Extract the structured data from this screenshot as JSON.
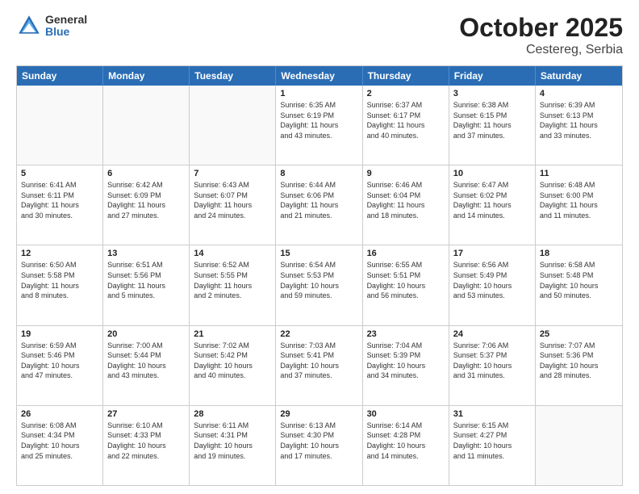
{
  "header": {
    "logo_general": "General",
    "logo_blue": "Blue",
    "title": "October 2025",
    "location": "Cestereg, Serbia"
  },
  "weekdays": [
    "Sunday",
    "Monday",
    "Tuesday",
    "Wednesday",
    "Thursday",
    "Friday",
    "Saturday"
  ],
  "rows": [
    [
      {
        "day": "",
        "info": ""
      },
      {
        "day": "",
        "info": ""
      },
      {
        "day": "",
        "info": ""
      },
      {
        "day": "1",
        "info": "Sunrise: 6:35 AM\nSunset: 6:19 PM\nDaylight: 11 hours\nand 43 minutes."
      },
      {
        "day": "2",
        "info": "Sunrise: 6:37 AM\nSunset: 6:17 PM\nDaylight: 11 hours\nand 40 minutes."
      },
      {
        "day": "3",
        "info": "Sunrise: 6:38 AM\nSunset: 6:15 PM\nDaylight: 11 hours\nand 37 minutes."
      },
      {
        "day": "4",
        "info": "Sunrise: 6:39 AM\nSunset: 6:13 PM\nDaylight: 11 hours\nand 33 minutes."
      }
    ],
    [
      {
        "day": "5",
        "info": "Sunrise: 6:41 AM\nSunset: 6:11 PM\nDaylight: 11 hours\nand 30 minutes."
      },
      {
        "day": "6",
        "info": "Sunrise: 6:42 AM\nSunset: 6:09 PM\nDaylight: 11 hours\nand 27 minutes."
      },
      {
        "day": "7",
        "info": "Sunrise: 6:43 AM\nSunset: 6:07 PM\nDaylight: 11 hours\nand 24 minutes."
      },
      {
        "day": "8",
        "info": "Sunrise: 6:44 AM\nSunset: 6:06 PM\nDaylight: 11 hours\nand 21 minutes."
      },
      {
        "day": "9",
        "info": "Sunrise: 6:46 AM\nSunset: 6:04 PM\nDaylight: 11 hours\nand 18 minutes."
      },
      {
        "day": "10",
        "info": "Sunrise: 6:47 AM\nSunset: 6:02 PM\nDaylight: 11 hours\nand 14 minutes."
      },
      {
        "day": "11",
        "info": "Sunrise: 6:48 AM\nSunset: 6:00 PM\nDaylight: 11 hours\nand 11 minutes."
      }
    ],
    [
      {
        "day": "12",
        "info": "Sunrise: 6:50 AM\nSunset: 5:58 PM\nDaylight: 11 hours\nand 8 minutes."
      },
      {
        "day": "13",
        "info": "Sunrise: 6:51 AM\nSunset: 5:56 PM\nDaylight: 11 hours\nand 5 minutes."
      },
      {
        "day": "14",
        "info": "Sunrise: 6:52 AM\nSunset: 5:55 PM\nDaylight: 11 hours\nand 2 minutes."
      },
      {
        "day": "15",
        "info": "Sunrise: 6:54 AM\nSunset: 5:53 PM\nDaylight: 10 hours\nand 59 minutes."
      },
      {
        "day": "16",
        "info": "Sunrise: 6:55 AM\nSunset: 5:51 PM\nDaylight: 10 hours\nand 56 minutes."
      },
      {
        "day": "17",
        "info": "Sunrise: 6:56 AM\nSunset: 5:49 PM\nDaylight: 10 hours\nand 53 minutes."
      },
      {
        "day": "18",
        "info": "Sunrise: 6:58 AM\nSunset: 5:48 PM\nDaylight: 10 hours\nand 50 minutes."
      }
    ],
    [
      {
        "day": "19",
        "info": "Sunrise: 6:59 AM\nSunset: 5:46 PM\nDaylight: 10 hours\nand 47 minutes."
      },
      {
        "day": "20",
        "info": "Sunrise: 7:00 AM\nSunset: 5:44 PM\nDaylight: 10 hours\nand 43 minutes."
      },
      {
        "day": "21",
        "info": "Sunrise: 7:02 AM\nSunset: 5:42 PM\nDaylight: 10 hours\nand 40 minutes."
      },
      {
        "day": "22",
        "info": "Sunrise: 7:03 AM\nSunset: 5:41 PM\nDaylight: 10 hours\nand 37 minutes."
      },
      {
        "day": "23",
        "info": "Sunrise: 7:04 AM\nSunset: 5:39 PM\nDaylight: 10 hours\nand 34 minutes."
      },
      {
        "day": "24",
        "info": "Sunrise: 7:06 AM\nSunset: 5:37 PM\nDaylight: 10 hours\nand 31 minutes."
      },
      {
        "day": "25",
        "info": "Sunrise: 7:07 AM\nSunset: 5:36 PM\nDaylight: 10 hours\nand 28 minutes."
      }
    ],
    [
      {
        "day": "26",
        "info": "Sunrise: 6:08 AM\nSunset: 4:34 PM\nDaylight: 10 hours\nand 25 minutes."
      },
      {
        "day": "27",
        "info": "Sunrise: 6:10 AM\nSunset: 4:33 PM\nDaylight: 10 hours\nand 22 minutes."
      },
      {
        "day": "28",
        "info": "Sunrise: 6:11 AM\nSunset: 4:31 PM\nDaylight: 10 hours\nand 19 minutes."
      },
      {
        "day": "29",
        "info": "Sunrise: 6:13 AM\nSunset: 4:30 PM\nDaylight: 10 hours\nand 17 minutes."
      },
      {
        "day": "30",
        "info": "Sunrise: 6:14 AM\nSunset: 4:28 PM\nDaylight: 10 hours\nand 14 minutes."
      },
      {
        "day": "31",
        "info": "Sunrise: 6:15 AM\nSunset: 4:27 PM\nDaylight: 10 hours\nand 11 minutes."
      },
      {
        "day": "",
        "info": ""
      }
    ]
  ]
}
